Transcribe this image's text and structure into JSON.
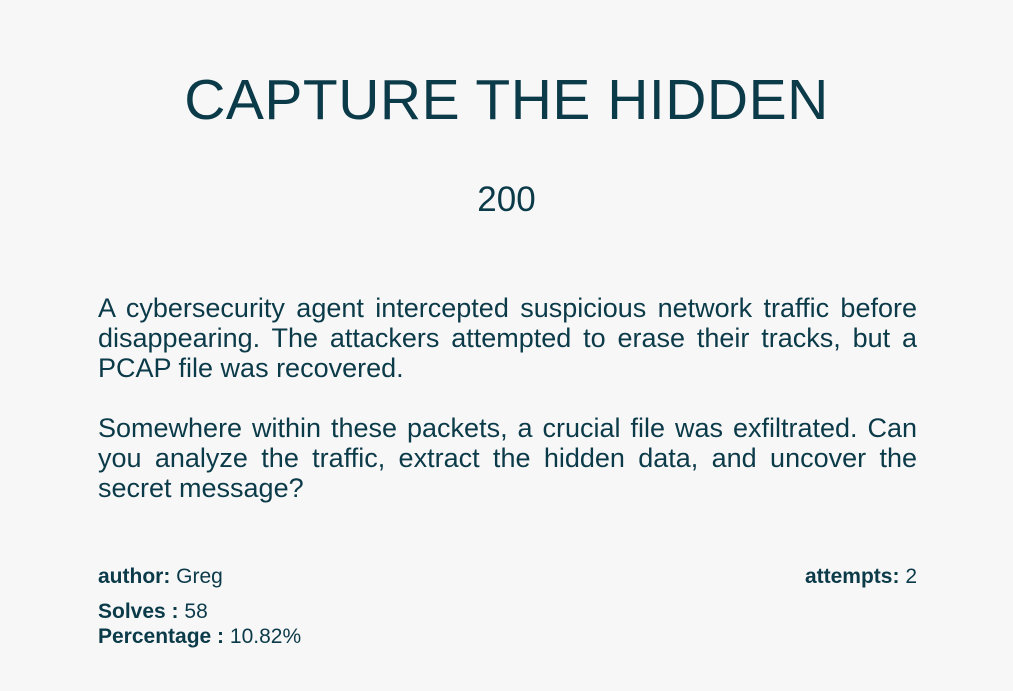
{
  "challenge": {
    "title": "CAPTURE THE HIDDEN",
    "points": "200",
    "description": [
      "A cybersecurity agent intercepted suspicious network traffic before disappearing. The attackers attempted to erase their tracks, but a PCAP file was recovered.",
      "Somewhere within these packets, a crucial file was exfiltrated. Can you analyze the traffic, extract the hidden data, and uncover the secret message?"
    ]
  },
  "meta": {
    "author_label": "author:",
    "author_value": "Greg",
    "attempts_label": "attempts:",
    "attempts_value": "2",
    "solves_label": "Solves :",
    "solves_value": "58",
    "percentage_label": "Percentage :",
    "percentage_value": "10.82%"
  }
}
